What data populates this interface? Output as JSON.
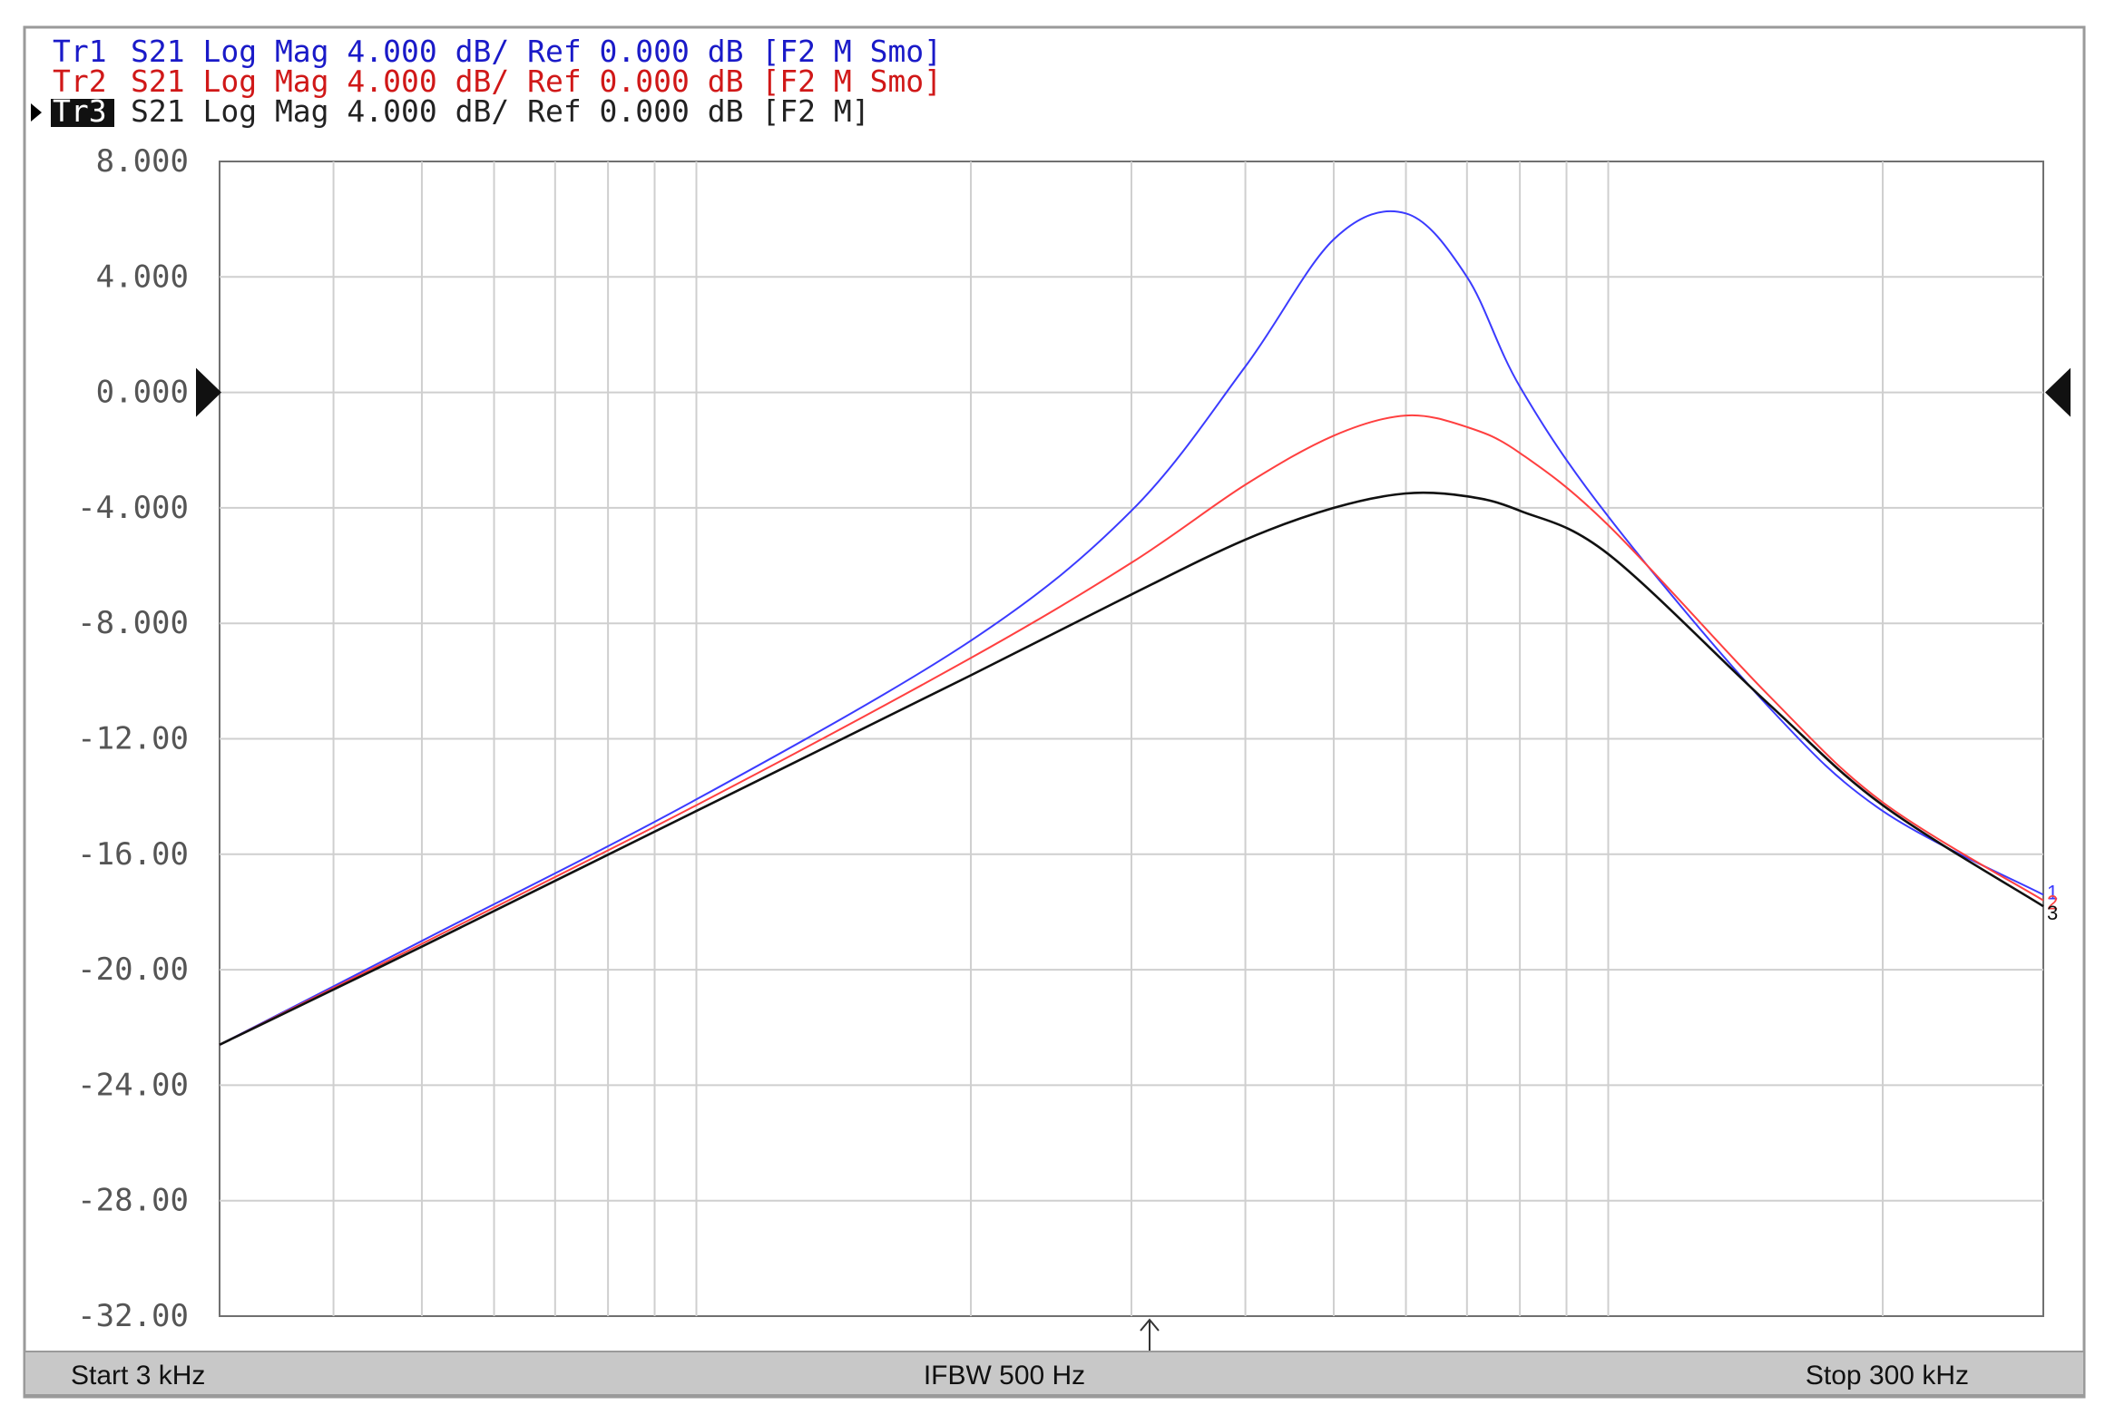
{
  "chart_data": {
    "type": "line",
    "title": "",
    "xlabel": "",
    "ylabel": "",
    "x_scale": "log",
    "xlim_hz": [
      3000,
      300000
    ],
    "ylim": [
      -32,
      8
    ],
    "grid": true,
    "trace_headers": [
      {
        "id": "Tr1",
        "text": "S21 Log Mag 4.000 dB/ Ref 0.000 dB [F2 M Smo]",
        "color": "#1a1ac8",
        "active": false
      },
      {
        "id": "Tr2",
        "text": "S21 Log Mag 4.000 dB/ Ref 0.000 dB [F2 M Smo]",
        "color": "#d01818",
        "active": false
      },
      {
        "id": "Tr3",
        "text": "S21 Log Mag 4.000 dB/ Ref 0.000 dB [F2 M]",
        "color": "#222222",
        "active": true
      }
    ],
    "y_ticks": [
      "8.000",
      "4.000",
      "0.000",
      "-4.000",
      "-8.000",
      "-12.00",
      "-16.00",
      "-20.00",
      "-24.00",
      "-28.00",
      "-32.00"
    ],
    "reference_level_db": 0,
    "series": [
      {
        "color": "#3b3bff",
        "end_label": "1",
        "x_hz": [
          3000,
          5000,
          10000,
          20000,
          30000,
          40000,
          50000,
          60000,
          70000,
          80000,
          100000,
          150000,
          200000,
          300000
        ],
        "values": [
          -22.6,
          -19.0,
          -14.1,
          -8.6,
          -4.1,
          0.9,
          5.3,
          6.2,
          4.0,
          0.2,
          -4.3,
          -10.9,
          -14.5,
          -17.4
        ]
      },
      {
        "color": "#ff4040",
        "end_label": "2",
        "x_hz": [
          3000,
          5000,
          10000,
          20000,
          30000,
          40000,
          50000,
          60000,
          70000,
          80000,
          100000,
          150000,
          200000,
          300000
        ],
        "values": [
          -22.6,
          -19.1,
          -14.3,
          -9.2,
          -5.9,
          -3.2,
          -1.5,
          -0.8,
          -1.2,
          -2.1,
          -4.6,
          -10.5,
          -14.2,
          -17.6
        ]
      },
      {
        "color": "#111111",
        "end_label": "3",
        "x_hz": [
          3000,
          5000,
          10000,
          20000,
          30000,
          40000,
          50000,
          60000,
          70000,
          80000,
          100000,
          150000,
          200000,
          300000
        ],
        "values": [
          -22.6,
          -19.2,
          -14.5,
          -9.8,
          -7.0,
          -5.1,
          -4.0,
          -3.5,
          -3.6,
          -4.1,
          -5.6,
          -10.8,
          -14.3,
          -17.8
        ]
      }
    ],
    "footer": {
      "start": "Start 3 kHz",
      "ifbw": "IFBW 500 Hz",
      "stop": "Stop 300 kHz"
    },
    "sweep_marker_hz": 30000
  }
}
